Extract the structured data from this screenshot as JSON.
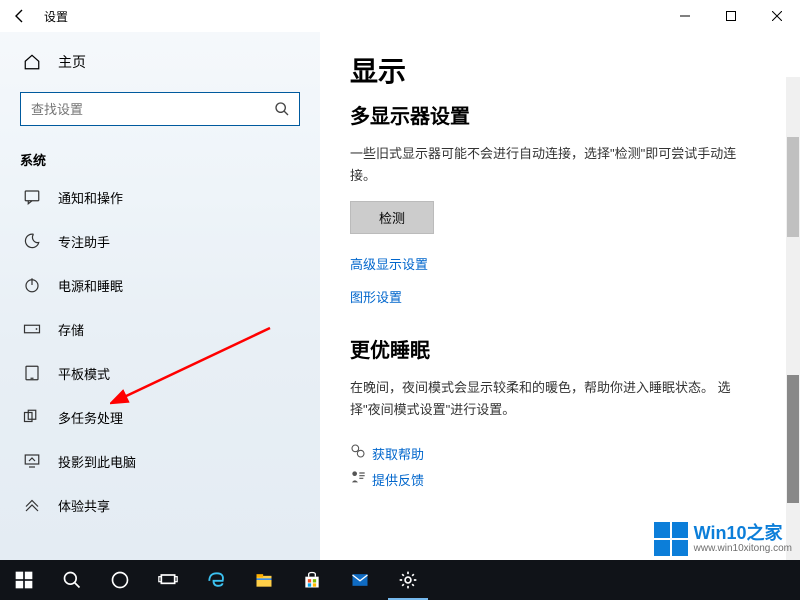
{
  "window": {
    "title": "设置",
    "min": "最小化",
    "max": "最大化",
    "close": "关闭"
  },
  "sidebar": {
    "home": "主页",
    "search_placeholder": "查找设置",
    "section": "系统",
    "items": [
      {
        "icon": "notify",
        "label": "通知和操作"
      },
      {
        "icon": "focus",
        "label": "专注助手"
      },
      {
        "icon": "power",
        "label": "电源和睡眠"
      },
      {
        "icon": "storage",
        "label": "存储"
      },
      {
        "icon": "tablet",
        "label": "平板模式"
      },
      {
        "icon": "multitask",
        "label": "多任务处理"
      },
      {
        "icon": "project",
        "label": "投影到此电脑"
      },
      {
        "icon": "share",
        "label": "体验共享"
      }
    ]
  },
  "main": {
    "title": "显示",
    "multi_title": "多显示器设置",
    "multi_hint": "一些旧式显示器可能不会进行自动连接，选择\"检测\"即可尝试手动连接。",
    "detect_btn": "检测",
    "link_adv": "高级显示设置",
    "link_gfx": "图形设置",
    "sleep_title": "更优睡眠",
    "sleep_hint": "在晚间，夜间模式会显示较柔和的暖色，帮助你进入睡眠状态。 选择\"夜间模式设置\"进行设置。",
    "help": "获取帮助",
    "feedback": "提供反馈"
  },
  "watermark": {
    "brand": "Win10之家",
    "url": "www.win10xitong.com"
  }
}
